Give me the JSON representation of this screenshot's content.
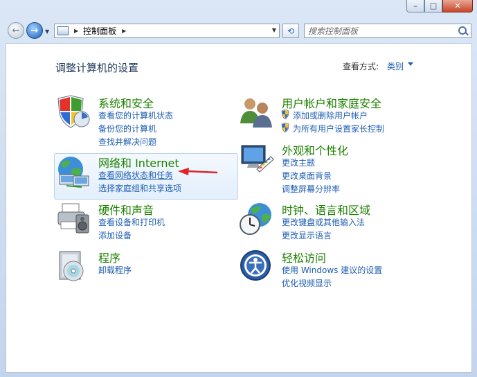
{
  "window": {
    "min": "–",
    "max": "□",
    "close": "✕"
  },
  "nav": {
    "back": "←",
    "forward": "→",
    "refresh": "⟲"
  },
  "address": {
    "crumb": "控制面板"
  },
  "search": {
    "placeholder": "搜索控制面板"
  },
  "page": {
    "heading": "调整计算机的设置",
    "view_by_label": "查看方式:",
    "view_by_value": "类别"
  },
  "categories": {
    "system": {
      "title": "系统和安全",
      "links": [
        "查看您的计算机状态",
        "备份您的计算机",
        "查找并解决问题"
      ]
    },
    "network": {
      "title": "网络和 Internet",
      "links": [
        "查看网络状态和任务",
        "选择家庭组和共享选项"
      ]
    },
    "hardware": {
      "title": "硬件和声音",
      "links": [
        "查看设备和打印机",
        "添加设备"
      ]
    },
    "programs": {
      "title": "程序",
      "links": [
        "卸载程序"
      ]
    },
    "users": {
      "title": "用户帐户和家庭安全",
      "links": [
        "添加或删除用户帐户",
        "为所有用户设置家长控制"
      ]
    },
    "appearance": {
      "title": "外观和个性化",
      "links": [
        "更改主题",
        "更改桌面背景",
        "调整屏幕分辨率"
      ]
    },
    "clock": {
      "title": "时钟、语言和区域",
      "links": [
        "更改键盘或其他输入法",
        "更改显示语言"
      ]
    },
    "ease": {
      "title": "轻松访问",
      "links": [
        "使用 Windows 建议的设置",
        "优化视频显示"
      ]
    }
  },
  "colors": {
    "link": "#1e5eb3",
    "title": "#1e8100",
    "heading": "#1e395b",
    "annotation_arrow": "#e0242a"
  }
}
